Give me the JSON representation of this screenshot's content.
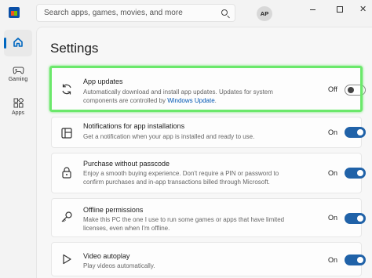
{
  "search": {
    "placeholder": "Search apps, games, movies, and more"
  },
  "account": {
    "initials": "AP"
  },
  "window_controls": {
    "close_glyph": "✕"
  },
  "nav": {
    "items": [
      {
        "label": "Gaming"
      },
      {
        "label": "Apps"
      }
    ]
  },
  "page": {
    "title": "Settings"
  },
  "settings": [
    {
      "title": "App updates",
      "description": "Automatically download and install app updates. Updates for system components are controlled by",
      "link": "Windows Update",
      "after_link": ".",
      "state": "Off",
      "enabled": false,
      "icon": "refresh-icon"
    },
    {
      "title": "Notifications for app installations",
      "description": "Get a notification when your app is installed and ready to use.",
      "state": "On",
      "enabled": true,
      "icon": "notification-icon"
    },
    {
      "title": "Purchase without passcode",
      "description": "Enjoy a smooth buying experience. Don't require a PIN or password to confirm purchases and in-app transactions billed through Microsoft.",
      "state": "On",
      "enabled": true,
      "icon": "lock-icon"
    },
    {
      "title": "Offline permissions",
      "description": "Make this PC the one I use to run some games or apps that have limited licenses, even when I'm offline.",
      "state": "On",
      "enabled": true,
      "icon": "key-icon"
    },
    {
      "title": "Video autoplay",
      "description": "Play videos automatically.",
      "state": "On",
      "enabled": true,
      "icon": "play-icon"
    }
  ],
  "colors": {
    "accent": "#2062a8",
    "highlight": "#6be86b",
    "link": "#0056b3"
  }
}
